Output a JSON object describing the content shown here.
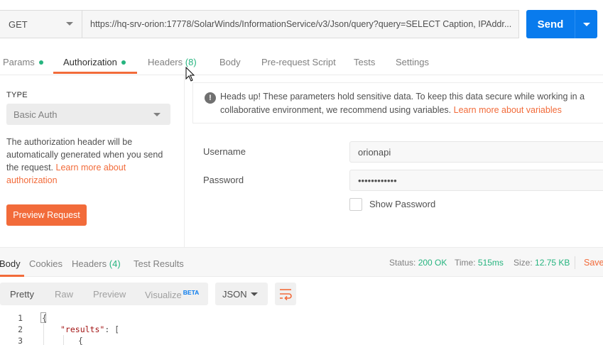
{
  "request": {
    "method": "GET",
    "url": "https://hq-srv-orion:17778/SolarWinds/InformationService/v3/Json/query?query=SELECT Caption, IPAddr...",
    "send_label": "Send"
  },
  "request_tabs": {
    "params": "Params",
    "authorization": "Authorization",
    "headers": "Headers",
    "headers_count": "(8)",
    "body": "Body",
    "pre_request": "Pre-request Script",
    "tests": "Tests",
    "settings": "Settings"
  },
  "auth": {
    "type_label": "TYPE",
    "type_value": "Basic Auth",
    "description": "The authorization header will be automatically generated when you send the request. ",
    "learn_more": "Learn more about authorization",
    "preview_button": "Preview Request",
    "notice": "Heads up! These parameters hold sensitive data. To keep this data secure while working in a collaborative environment, we recommend using variables. ",
    "notice_link": "Learn more about variables",
    "username_label": "Username",
    "username_value": "orionapi",
    "password_label": "Password",
    "password_value": "••••••••••••",
    "show_password": "Show Password"
  },
  "response_tabs": {
    "body": "Body",
    "cookies": "Cookies",
    "headers": "Headers",
    "headers_count": "(4)",
    "test_results": "Test Results"
  },
  "response_status": {
    "status_label": "Status:",
    "status_value": "200 OK",
    "time_label": "Time:",
    "time_value": "515ms",
    "size_label": "Size:",
    "size_value": "12.75 KB",
    "save": "Save"
  },
  "format_bar": {
    "pretty": "Pretty",
    "raw": "Raw",
    "preview": "Preview",
    "visualize": "Visualize",
    "beta": "BETA",
    "format": "JSON"
  },
  "code": {
    "lines": [
      {
        "no": "1",
        "text": "{"
      },
      {
        "no": "2",
        "key": "\"results\"",
        "rest": ": ["
      },
      {
        "no": "3",
        "text": "{"
      }
    ]
  },
  "colors": {
    "accent": "#f26b3a",
    "primary": "#097bed",
    "success": "#26b47f"
  }
}
